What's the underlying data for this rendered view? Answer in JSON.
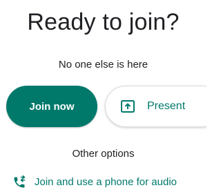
{
  "heading": {
    "title": "Ready to join?"
  },
  "status": {
    "text": "No one else is here"
  },
  "actions": {
    "join_label": "Join now",
    "present_label": "Present"
  },
  "other": {
    "header": "Other options",
    "phone_audio_label": "Join and use a phone for audio"
  },
  "colors": {
    "accent": "#00796b",
    "text": "#202124",
    "border": "#dadce0"
  },
  "icons": {
    "present": "present-to-all-icon",
    "phone": "phone-forward-icon"
  }
}
